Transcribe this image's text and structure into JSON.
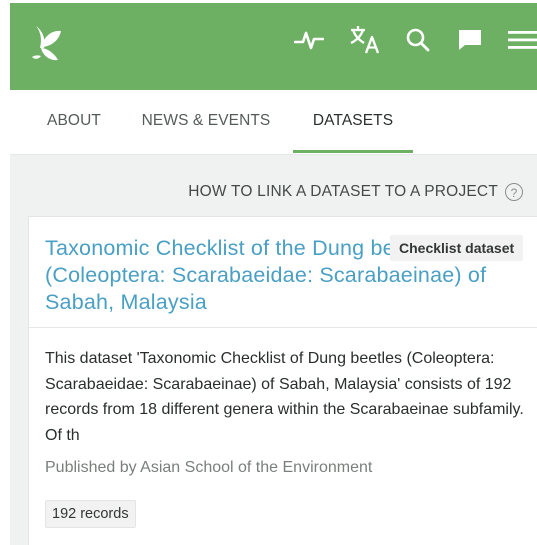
{
  "header": {
    "icons": [
      "leaf-logo-icon",
      "activity-icon",
      "translate-icon",
      "search-icon",
      "feedback-icon",
      "menu-icon"
    ],
    "brand_color": "#6db063"
  },
  "tabs": [
    {
      "label": "ABOUT",
      "active": false
    },
    {
      "label": "NEWS & EVENTS",
      "active": false
    },
    {
      "label": "DATASETS",
      "active": true
    }
  ],
  "link_dataset": {
    "label": "HOW TO LINK A DATASET TO A PROJECT",
    "help_glyph": "?"
  },
  "dataset_card": {
    "title": "Taxonomic Checklist of the Dung beetles (Coleoptera: Scarabaeidae: Scarabaeinae) of Sabah, Malaysia",
    "type_badge": "Checklist dataset",
    "description": "This dataset 'Taxonomic Checklist of Dung beetles (Coleoptera: Scarabaeidae: Scarabaeinae) of Sabah, Malaysia' consists of 192 records from 18 different genera within the Scarabaeinae subfamily. Of th",
    "publisher": "Published by Asian School of the Environment",
    "records_badge": "192 records",
    "title_color": "#4a9fc4"
  }
}
